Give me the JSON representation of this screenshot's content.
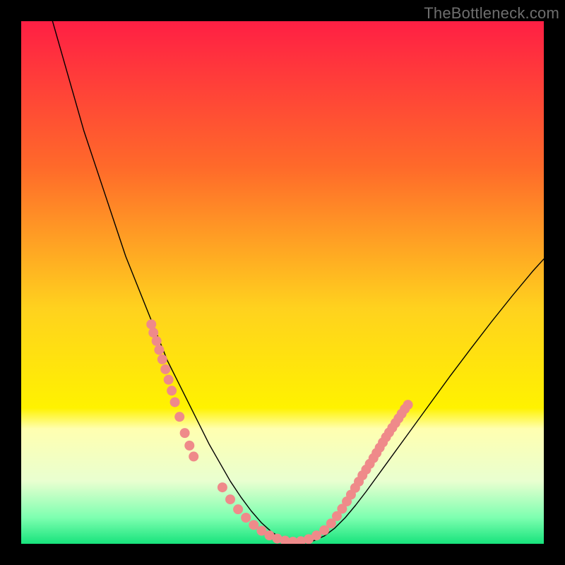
{
  "watermark": "TheBottleneck.com",
  "chart_data": {
    "type": "line",
    "title": "",
    "xlabel": "",
    "ylabel": "",
    "xlim": [
      0,
      100
    ],
    "ylim": [
      0,
      100
    ],
    "gradient_stops": [
      {
        "offset": 0.0,
        "color": "#ff1f44"
      },
      {
        "offset": 0.28,
        "color": "#ff6a2a"
      },
      {
        "offset": 0.55,
        "color": "#ffd21e"
      },
      {
        "offset": 0.74,
        "color": "#fff200"
      },
      {
        "offset": 0.78,
        "color": "#ffffb0"
      },
      {
        "offset": 0.88,
        "color": "#e9ffd0"
      },
      {
        "offset": 0.95,
        "color": "#7dffb0"
      },
      {
        "offset": 1.0,
        "color": "#17e37c"
      }
    ],
    "series": [
      {
        "name": "curve",
        "color": "#000000",
        "stroke_width": 1.4,
        "x": [
          6,
          8,
          10,
          12,
          14,
          16,
          18,
          20,
          22,
          24,
          26,
          28,
          30,
          32,
          34,
          36,
          38,
          40,
          42,
          44,
          46,
          48,
          50,
          52,
          54,
          56,
          58,
          60,
          62,
          64,
          66,
          70,
          74,
          78,
          82,
          86,
          90,
          94,
          98,
          100
        ],
        "y": [
          100,
          93,
          86,
          79,
          73,
          67,
          61,
          55,
          50,
          45,
          40,
          35,
          31,
          27,
          23,
          19,
          15.5,
          12,
          9,
          6.3,
          4,
          2.2,
          1,
          0.4,
          0.2,
          0.6,
          1.5,
          3,
          5,
          7.4,
          10,
          15.5,
          21,
          26.5,
          32,
          37.3,
          42.5,
          47.5,
          52.3,
          54.5
        ]
      },
      {
        "name": "highlight-dots-left",
        "color": "#ef8a8a",
        "marker_r": 7,
        "x": [
          24.9,
          25.3,
          25.9,
          26.4,
          27.0,
          27.6,
          28.2,
          28.8,
          29.4,
          30.3,
          31.3,
          32.2,
          33.0
        ],
        "y": [
          42.0,
          40.4,
          38.8,
          37.1,
          35.3,
          33.4,
          31.4,
          29.3,
          27.1,
          24.3,
          21.2,
          18.8,
          16.7
        ]
      },
      {
        "name": "highlight-dots-bottom",
        "color": "#ef8a8a",
        "marker_r": 7,
        "x": [
          38.5,
          40.0,
          41.5,
          43.0,
          44.5,
          46.0,
          47.5,
          49.0,
          50.5,
          52.0,
          53.5,
          55.0,
          56.5,
          58.0,
          59.3
        ],
        "y": [
          10.8,
          8.5,
          6.6,
          5.0,
          3.6,
          2.5,
          1.6,
          1.0,
          0.6,
          0.4,
          0.5,
          0.9,
          1.6,
          2.6,
          3.9
        ]
      },
      {
        "name": "highlight-dots-right",
        "color": "#ef8a8a",
        "marker_r": 7,
        "x": [
          60.4,
          61.4,
          62.3,
          63.1,
          63.9,
          64.6,
          65.3,
          66.0,
          66.7,
          67.4,
          68.0,
          68.6,
          69.2,
          69.8,
          70.4,
          71.0,
          71.6,
          72.2,
          72.8,
          73.4,
          74.0
        ],
        "y": [
          5.3,
          6.7,
          8.1,
          9.4,
          10.7,
          11.9,
          13.1,
          14.2,
          15.3,
          16.4,
          17.4,
          18.4,
          19.4,
          20.4,
          21.3,
          22.2,
          23.1,
          24.0,
          24.9,
          25.8,
          26.6
        ]
      }
    ]
  }
}
